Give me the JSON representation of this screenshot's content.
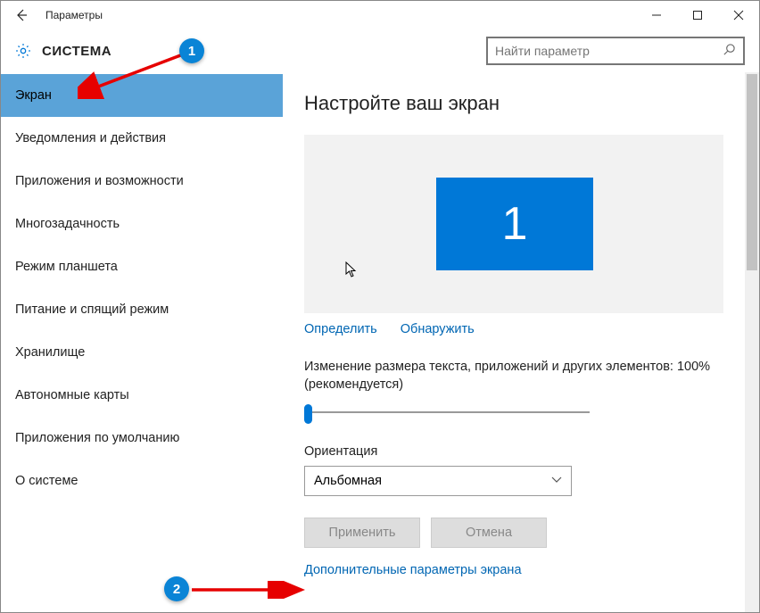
{
  "window_title": "Параметры",
  "section_title": "СИСТЕМА",
  "search_placeholder": "Найти параметр",
  "sidebar": {
    "items": [
      {
        "label": "Экран",
        "selected": true
      },
      {
        "label": "Уведомления и действия",
        "selected": false
      },
      {
        "label": "Приложения и возможности",
        "selected": false
      },
      {
        "label": "Многозадачность",
        "selected": false
      },
      {
        "label": "Режим планшета",
        "selected": false
      },
      {
        "label": "Питание и спящий режим",
        "selected": false
      },
      {
        "label": "Хранилище",
        "selected": false
      },
      {
        "label": "Автономные карты",
        "selected": false
      },
      {
        "label": "Приложения по умолчанию",
        "selected": false
      },
      {
        "label": "О системе",
        "selected": false
      }
    ]
  },
  "content": {
    "page_title": "Настройте ваш экран",
    "monitor_number": "1",
    "identify_link": "Определить",
    "detect_link": "Обнаружить",
    "scale_label": "Изменение размера текста, приложений и других элементов: 100% (рекомендуется)",
    "orientation_label": "Ориентация",
    "orientation_value": "Альбомная",
    "apply_btn": "Применить",
    "cancel_btn": "Отмена",
    "advanced_link": "Дополнительные параметры экрана"
  },
  "annotations": {
    "badge1": "1",
    "badge2": "2"
  }
}
